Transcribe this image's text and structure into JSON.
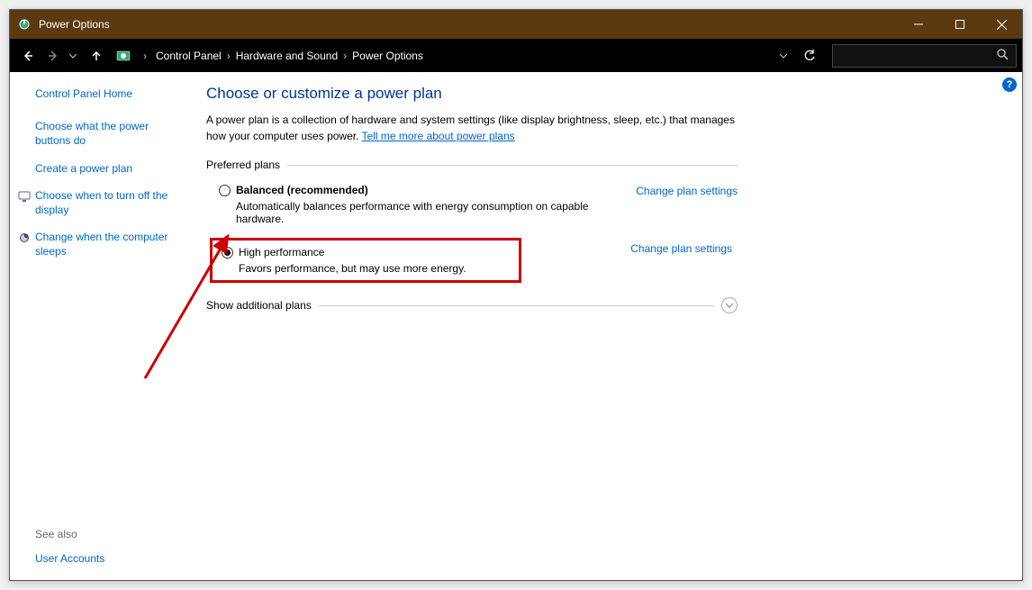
{
  "titlebar": {
    "title": "Power Options"
  },
  "breadcrumbs": {
    "b1": "Control Panel",
    "b2": "Hardware and Sound",
    "b3": "Power Options"
  },
  "sidebar": {
    "home": "Control Panel Home",
    "l1": "Choose what the power buttons do",
    "l2": "Create a power plan",
    "l3": "Choose when to turn off the display",
    "l4": "Change when the computer sleeps",
    "see_also": "See also",
    "l5": "User Accounts"
  },
  "main": {
    "title": "Choose or customize a power plan",
    "desc1": "A power plan is a collection of hardware and system settings (like display brightness, sleep, etc.) that manages how your computer uses power. ",
    "desc_link": "Tell me more about power plans",
    "preferred": "Preferred plans",
    "plan1_name": "Balanced (recommended)",
    "plan1_desc": "Automatically balances performance with energy consumption on capable hardware.",
    "plan2_name": "High performance",
    "plan2_desc": "Favors performance, but may use more energy.",
    "change": "Change plan settings",
    "show_additional": "Show additional plans"
  }
}
